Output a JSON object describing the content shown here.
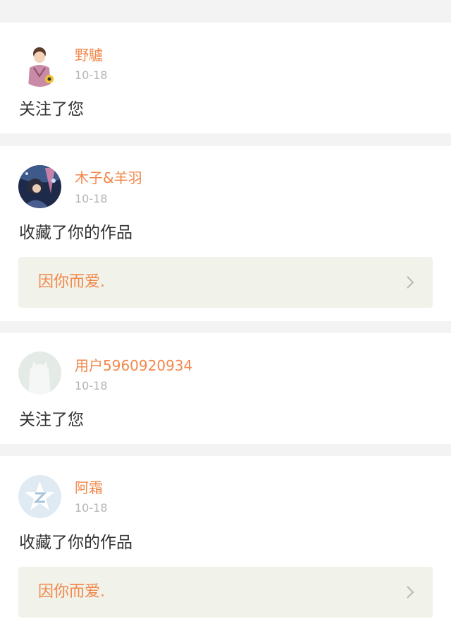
{
  "colors": {
    "accent": "#f2874a",
    "card_bg": "#ffffff",
    "page_bg": "#f3f3f3",
    "work_bg": "#f1f2e9",
    "date": "#b5b5b5",
    "text": "#333333",
    "chevron": "#b8b8b8"
  },
  "notifications": [
    {
      "user": "野驢",
      "date": "10-18",
      "action": "关注了您",
      "avatar_icon": "cartoon-boy-avatar"
    },
    {
      "user": "木子&羊羽",
      "date": "10-18",
      "action": "收藏了你的作品",
      "work_title": "因你而爱.",
      "avatar_icon": "anime-illustration-avatar"
    },
    {
      "user": "用户5960920934",
      "date": "10-18",
      "action": "关注了您",
      "avatar_icon": "default-user-avatar"
    },
    {
      "user": "阿霜",
      "date": "10-18",
      "action": "收藏了你的作品",
      "work_title": "因你而爱.",
      "avatar_icon": "qzone-star-avatar"
    }
  ]
}
